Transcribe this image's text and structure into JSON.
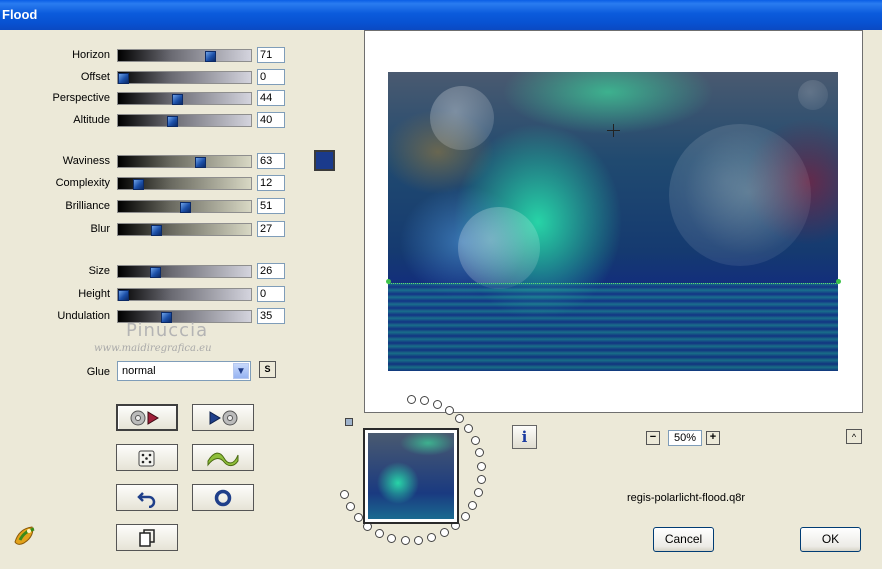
{
  "window": {
    "title": "Flood"
  },
  "sliders": [
    {
      "id": "horizon",
      "label": "Horizon",
      "value": "71",
      "fraction": 0.71,
      "track": "dark-light"
    },
    {
      "id": "offset",
      "label": "Offset",
      "value": "0",
      "fraction": 0.0,
      "track": "dark-light"
    },
    {
      "id": "perspective",
      "label": "Perspective",
      "value": "44",
      "fraction": 0.44,
      "track": "dark-light"
    },
    {
      "id": "altitude",
      "label": "Altitude",
      "value": "40",
      "fraction": 0.4,
      "track": "dark-light"
    },
    {
      "id": "waviness",
      "label": "Waviness",
      "value": "63",
      "fraction": 0.63,
      "track": "dark-beige"
    },
    {
      "id": "complexity",
      "label": "Complexity",
      "value": "12",
      "fraction": 0.12,
      "track": "dark-beige"
    },
    {
      "id": "brilliance",
      "label": "Brilliance",
      "value": "51",
      "fraction": 0.51,
      "track": "dark-beige"
    },
    {
      "id": "blur",
      "label": "Blur",
      "value": "27",
      "fraction": 0.27,
      "track": "dark-beige"
    },
    {
      "id": "size",
      "label": "Size",
      "value": "26",
      "fraction": 0.26,
      "track": "dark-light"
    },
    {
      "id": "height",
      "label": "Height",
      "value": "0",
      "fraction": 0.0,
      "track": "dark-light"
    },
    {
      "id": "undulation",
      "label": "Undulation",
      "value": "35",
      "fraction": 0.35,
      "track": "dark-light"
    }
  ],
  "color_swatch": {
    "color": "#1a3a8c"
  },
  "watermark": {
    "name": "Pinuccia",
    "url": "www.maidiregrafica.eu"
  },
  "glue": {
    "label": "Glue",
    "value": "normal",
    "s_button": "S"
  },
  "preview": {
    "zoom": "50%",
    "minus": "−",
    "plus": "+",
    "up": "^",
    "info": "i"
  },
  "filename": "regis-polarlicht-flood.q8r",
  "buttons": {
    "cancel": "Cancel",
    "ok": "OK"
  },
  "colors": {
    "titlebar": "#0b5bdc",
    "thumb": "#1b4fa8",
    "background": "#ece9d8"
  }
}
